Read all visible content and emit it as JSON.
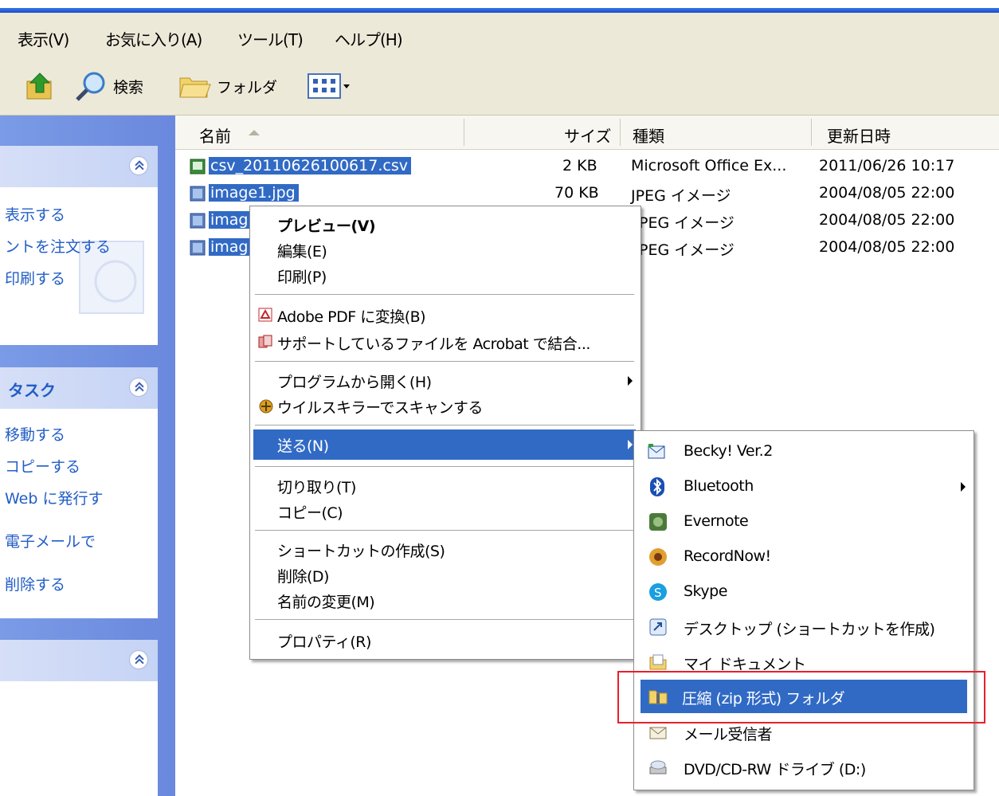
{
  "menubar": {
    "items": [
      "表示(V)",
      "お気に入り(A)",
      "ツール(T)",
      "ヘルプ(H)"
    ]
  },
  "toolbar": {
    "search_label": "検索",
    "folders_label": "フォルダ"
  },
  "sidebar": {
    "panel1_links": [
      "表示する",
      "ントを注文する",
      "印刷する"
    ],
    "panel2_title": "タスク",
    "panel2_links": [
      "移動する",
      "コピーする",
      "Web に発行す",
      "電子メールで",
      "削除する"
    ]
  },
  "columns": {
    "name": "名前",
    "size": "サイズ",
    "type": "種類",
    "modified": "更新日時"
  },
  "files": [
    {
      "name": "csv_20110626100617.csv",
      "size": "2 KB",
      "type": "Microsoft Office Ex...",
      "modified": "2011/06/26 10:17"
    },
    {
      "name": "image1.jpg",
      "size": "70 KB",
      "type": "JPEG イメージ",
      "modified": "2004/08/05 22:00"
    },
    {
      "name": "imag",
      "size": "",
      "type": "PEG イメージ",
      "modified": "2004/08/05 22:00"
    },
    {
      "name": "imag",
      "size": "",
      "type": "PEG イメージ",
      "modified": "2004/08/05 22:00"
    }
  ],
  "context_menu": {
    "preview": "プレビュー(V)",
    "edit": "編集(E)",
    "print": "印刷(P)",
    "adobe_pdf": "Adobe PDF に変換(B)",
    "acrobat_combine": "サポートしているファイルを Acrobat で結合...",
    "open_with": "プログラムから開く(H)",
    "virus_scan": "ウイルスキラーでスキャンする",
    "send_to": "送る(N)",
    "cut": "切り取り(T)",
    "copy": "コピー(C)",
    "create_shortcut": "ショートカットの作成(S)",
    "delete": "削除(D)",
    "rename": "名前の変更(M)",
    "properties": "プロパティ(R)"
  },
  "send_to_menu": {
    "becky": "Becky! Ver.2",
    "bluetooth": "Bluetooth",
    "evernote": "Evernote",
    "recordnow": "RecordNow!",
    "skype": "Skype",
    "desktop": "デスクトップ (ショートカットを作成)",
    "my_documents": "マイ ドキュメント",
    "zip_folder": "圧縮 (zip 形式) フォルダ",
    "mail_recipient": "メール受信者",
    "dvd_drive": "DVD/CD-RW ドライブ (D:)"
  },
  "colors": {
    "selection": "#316ac5",
    "highlight_box": "#e8202a",
    "task_link": "#215dc6"
  }
}
